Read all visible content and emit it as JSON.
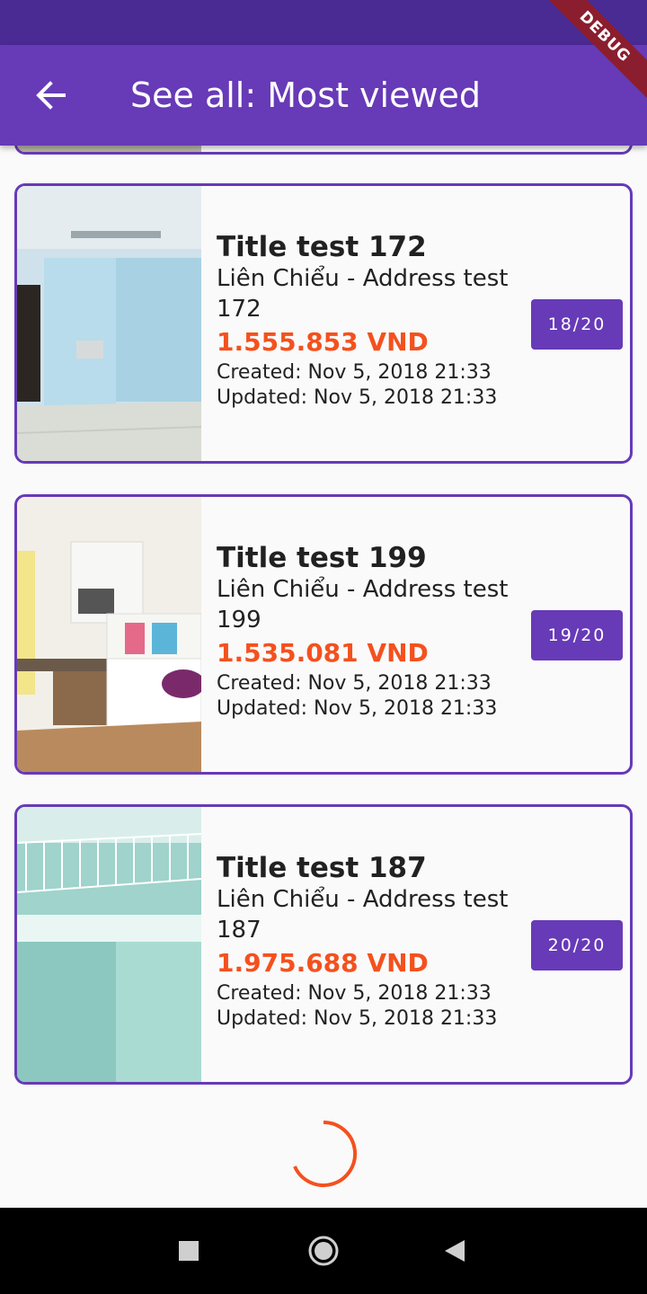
{
  "app_bar": {
    "title": "See all: Most viewed"
  },
  "debug_banner": "DEBUG",
  "listings": [
    {
      "title": "Title test 172",
      "address": "Liên Chiểu - Address test 172",
      "price": "1.555.853 VND",
      "created": "Created: Nov 5, 2018 21:33",
      "updated": "Updated: Nov 5, 2018 21:33",
      "rank": "18/20"
    },
    {
      "title": "Title test 199",
      "address": "Liên Chiểu - Address test 199",
      "price": "1.535.081 VND",
      "created": "Created: Nov 5, 2018 21:33",
      "updated": "Updated: Nov 5, 2018 21:33",
      "rank": "19/20"
    },
    {
      "title": "Title test 187",
      "address": "Liên Chiểu - Address test 187",
      "price": "1.975.688 VND",
      "created": "Created: Nov 5, 2018 21:33",
      "updated": "Updated: Nov 5, 2018 21:33",
      "rank": "20/20"
    }
  ],
  "colors": {
    "primary": "#673ab7",
    "accent": "#f4511e",
    "status_bar": "#4a2a93"
  },
  "icons": {
    "back": "arrow-back-icon",
    "nav_recent": "square-icon",
    "nav_home": "circle-icon",
    "nav_back": "triangle-back-icon"
  }
}
